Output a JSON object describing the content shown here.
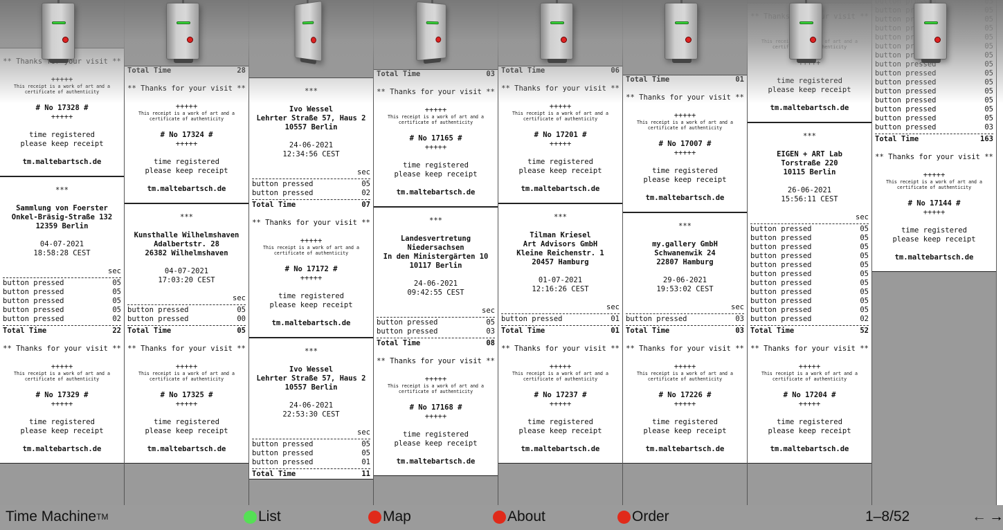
{
  "footer": {
    "title": "Time Machine",
    "tm": "TM",
    "nav": [
      {
        "label": "List",
        "color": "#55e055"
      },
      {
        "label": "Map",
        "color": "#e02a1a"
      },
      {
        "label": "About",
        "color": "#e02a1a"
      },
      {
        "label": "Order",
        "color": "#e02a1a"
      }
    ],
    "pagination": "1–8/52",
    "prev_arrow": "←",
    "next_arrow": "→"
  },
  "receipt_text": {
    "thanks": "** Thanks for your visit **",
    "stars5": "+++++",
    "art_line1": "This receipt is a work of art and a",
    "art_line2": "certificate of authenticity",
    "registered": "time registered",
    "keep": "please keep receipt",
    "site": "tm.maltebartsch.de",
    "stars3": "***",
    "sec": "sec",
    "total": "Total Time",
    "pressed": "button pressed"
  },
  "columns": [
    {
      "top_partial": {
        "thanks": "** Thank   ur visit **",
        "number": "# No 17328 #"
      },
      "receipt": {
        "venue": [
          "Sammlung von Foerster",
          "Onkel-Bräsig-Straße 132",
          "12359 Berlin"
        ],
        "date": "04-07-2021",
        "time": "18:58:28 CEST",
        "presses": [
          "05",
          "05",
          "05",
          "05",
          "02"
        ],
        "total": "22",
        "number": "# No 17329 #"
      }
    },
    {
      "top_partial": {
        "total": "28",
        "number": "# No 17324 #"
      },
      "receipt": {
        "venue": [
          "Kunsthalle Wilhelmshaven",
          "Adalbertstr. 28",
          "26382 Wilhelmshaven"
        ],
        "date": "04-07-2021",
        "time": "17:03:20 CEST",
        "presses": [
          "05",
          "00"
        ],
        "total": "05",
        "number": "# No 17325 #"
      }
    },
    {
      "top_partial": {
        "venue": [
          "Ivo Wessel",
          "Lehrter Straße 57, Haus 2",
          "10557 Berlin"
        ],
        "date": "24-06-2021",
        "time": "12:34:56 CEST",
        "presses": [
          "05",
          "02"
        ],
        "total": "07",
        "number": "# No 17172 #"
      },
      "receipt": {
        "venue": [
          "Ivo Wessel",
          "Lehrter Straße 57, Haus 2",
          "10557 Berlin"
        ],
        "date": "24-06-2021",
        "time": "22:53:30 CEST",
        "presses": [
          "05",
          "05",
          "01"
        ],
        "total": "11"
      }
    },
    {
      "top_partial": {
        "total": "03",
        "number": "# No 17165 #"
      },
      "receipt": {
        "venue": [
          "Landesvertretung",
          "Niedersachsen",
          "In den Ministergärten 10",
          "10117 Berlin"
        ],
        "date": "24-06-2021",
        "time": "09:42:55 CEST",
        "presses": [
          "05",
          "03"
        ],
        "total": "08",
        "number": "# No 17168 #"
      }
    },
    {
      "top_partial": {
        "total": "06",
        "number": "# No 17201 #"
      },
      "receipt": {
        "venue": [
          "Tilman Kriesel",
          "Art Advisors GmbH",
          "Kleine Reichenstr. 1",
          "20457 Hamburg"
        ],
        "date": "01-07-2021",
        "time": "12:16:26 CEST",
        "presses": [
          "01"
        ],
        "total": "01",
        "number": "# No 17237 #"
      }
    },
    {
      "top_partial": {
        "total": "01",
        "number": "# No 17007 #"
      },
      "receipt": {
        "venue": [
          "my.gallery GmbH",
          "Schwanenwik 24",
          "22807 Hamburg"
        ],
        "date": "29-06-2021",
        "time": "19:53:02 CEST",
        "presses": [
          "03"
        ],
        "total": "03",
        "number": "# No 17226 #"
      }
    },
    {
      "top_partial": {},
      "receipt": {
        "venue": [
          "EIGEN + ART Lab",
          "Torstraße 220",
          "10115 Berlin"
        ],
        "date": "26-06-2021",
        "time": "15:56:11 CEST",
        "presses": [
          "05",
          "05",
          "05",
          "05",
          "05",
          "05",
          "05",
          "05",
          "05",
          "05",
          "02"
        ],
        "total": "52",
        "number": "# No 17204 #"
      }
    },
    {
      "top_partial": {},
      "receipt": {
        "presses": [
          "05",
          "05",
          "05",
          "05",
          "05",
          "05",
          "05",
          "05",
          "05",
          "05",
          "05",
          "05",
          "05",
          "05",
          "05",
          "05",
          "05",
          "05",
          "05",
          "05",
          "05",
          "05",
          "05",
          "05",
          "05",
          "05",
          "05",
          "05",
          "05",
          "05",
          "05",
          "05",
          "03"
        ],
        "total": "163",
        "number": "# No 17144 #"
      }
    }
  ]
}
